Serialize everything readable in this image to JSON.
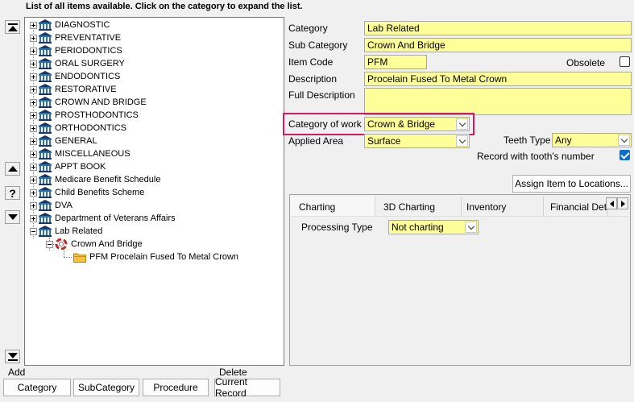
{
  "header": {
    "instructions": "List of all items available. Click on the category to expand the list."
  },
  "side_buttons": {
    "help": "?"
  },
  "tree": {
    "categories": [
      "DIAGNOSTIC",
      "PREVENTATIVE",
      "PERIODONTICS",
      "ORAL SURGERY",
      "ENDODONTICS",
      "RESTORATIVE",
      "CROWN AND BRIDGE",
      "PROSTHODONTICS",
      "ORTHODONTICS",
      "GENERAL",
      "MISCELLANEOUS",
      "APPT BOOK",
      "Medicare Benefit Schedule",
      "Child Benefits Scheme",
      "DVA",
      "Department of Veterans Affairs",
      "Lab Related"
    ],
    "subcategory": "Crown And Bridge",
    "item": "PFM Procelain Fused To Metal Crown"
  },
  "form": {
    "category_label": "Category",
    "category_value": "Lab Related",
    "subcategory_label": "Sub Category",
    "subcategory_value": "Crown And Bridge",
    "itemcode_label": "Item Code",
    "itemcode_value": "PFM",
    "obsolete_label": "Obsolete",
    "obsolete_checked": false,
    "description_label": "Description",
    "description_value": "Procelain Fused To Metal Crown",
    "full_description_label": "Full Description",
    "full_description_value": "",
    "category_of_work_label": "Category of work",
    "category_of_work_value": "Crown & Bridge",
    "applied_area_label": "Applied Area",
    "applied_area_value": "Surface",
    "teeth_type_label": "Teeth Type",
    "teeth_type_value": "Any",
    "record_tooth_label": "Record with tooth's number",
    "record_tooth_checked": true,
    "assign_button": "Assign Item to Locations..."
  },
  "tabs": [
    "Charting",
    "3D Charting",
    "Inventory",
    "Financial Details"
  ],
  "charting": {
    "processing_type_label": "Processing Type",
    "processing_type_value": "Not charting"
  },
  "bottom": {
    "add_label": "Add",
    "delete_label": "Delete",
    "category_button": "Category",
    "subcategory_button": "SubCategory",
    "procedure_button": "Procedure",
    "current_record_button": "Current Record"
  },
  "colors": {
    "field_bg": "#ffff99",
    "highlight": "#d81b60",
    "checkbox_blue": "#0b6fce"
  }
}
